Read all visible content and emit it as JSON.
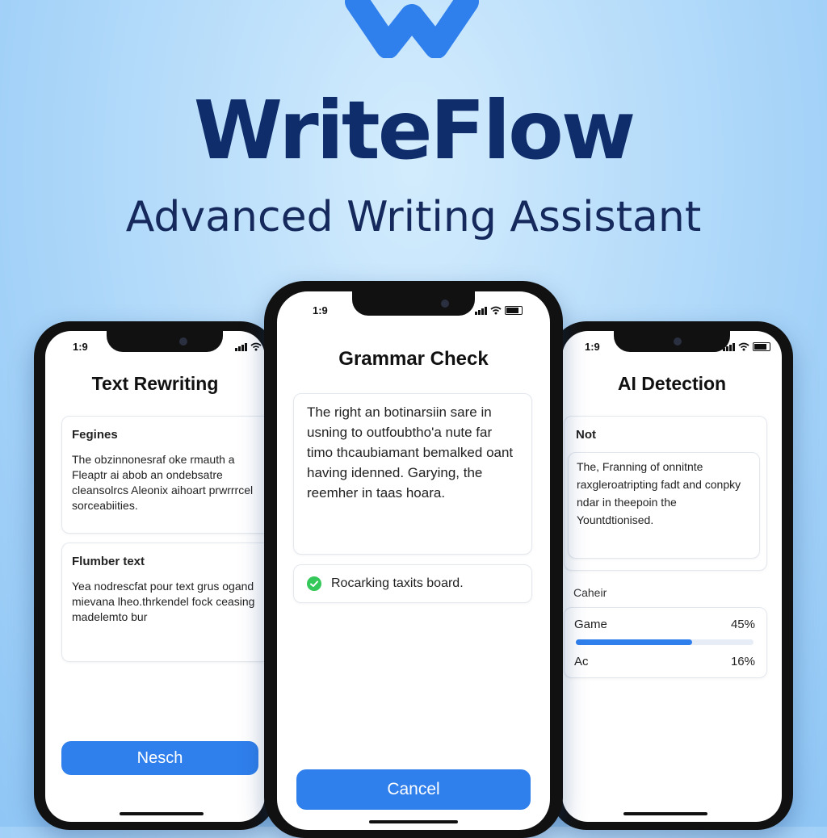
{
  "brand": {
    "name": "WriteFlow",
    "tagline": "Advanced Writing Assistant",
    "logo_color": "#2f7fec",
    "title_color": "#0f2d6b"
  },
  "phones": {
    "left": {
      "time": "1:9",
      "title": "Text Rewriting",
      "card1": {
        "title": "Fegines",
        "text": "The obzinnonesraf oke rmauth a Fleaptr ai abob an ondebsatre cleansolrcs Aleonix aihoart prwrrrcel sorceabiities."
      },
      "card2": {
        "title": "Flumber text",
        "text": "Yea nodrescfat pour text grus ogand mievana lheo.thrkendel fock ceasing madelemto bur"
      },
      "button": "Nesch"
    },
    "center": {
      "time": "1:9",
      "title": "Grammar Check",
      "text_card": "The right an botinarsiin sare in usning to outfoubtho'a nute far timo thcaubiamant bemalked oant having idenned. Garying, the reemher in taas hoara.",
      "status_text": "Rocarking taxits board.",
      "status_icon": "check-circle-icon",
      "button": "Cancel"
    },
    "right": {
      "time": "1:9",
      "title": "AI Detection",
      "card_title": "Not",
      "card_text": "The, Franning of onnitnte raxgleroatripting fadt and conpky ndar in theepoin the Yountdtionised.",
      "section_label": "Caheir",
      "rows": [
        {
          "label": "Game",
          "value": "45%",
          "fraction": 0.45
        },
        {
          "label": "Ac",
          "value": "16%"
        }
      ],
      "accent": "#2f7fec"
    }
  }
}
